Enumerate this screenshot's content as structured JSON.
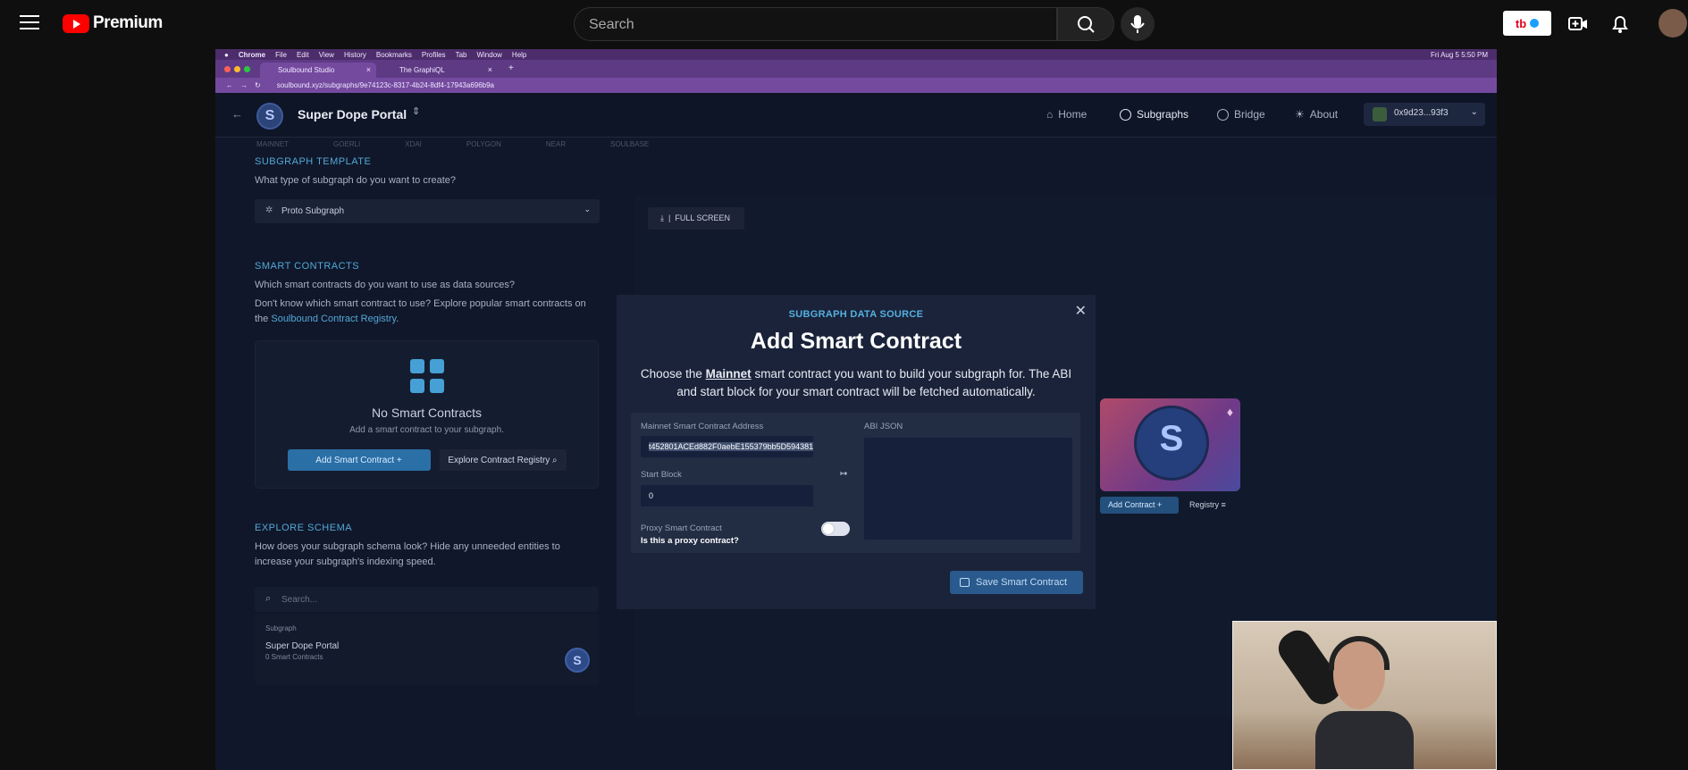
{
  "youtube": {
    "brand": "Premium",
    "search_placeholder": "Search",
    "partner_logo_text": "tb"
  },
  "mac_menu": {
    "items": [
      "Chrome",
      "File",
      "Edit",
      "View",
      "History",
      "Bookmarks",
      "Profiles",
      "Tab",
      "Window",
      "Help"
    ],
    "clock": "Fri Aug 5  5:50 PM"
  },
  "browser": {
    "tabs": [
      {
        "label": "Soulbound Studio",
        "active": true
      },
      {
        "label": "The GraphiQL",
        "active": false
      }
    ],
    "url": "soulbound.xyz/subgraphs/9e74123c-8317-4b24-8df4-17943a696b9a"
  },
  "app": {
    "portal_name": "Super Dope Portal",
    "nav": [
      {
        "label": "Home",
        "active": false
      },
      {
        "label": "Subgraphs",
        "active": true
      },
      {
        "label": "Bridge",
        "active": false
      },
      {
        "label": "About",
        "active": false
      }
    ],
    "wallet": "0x9d23...93f3",
    "chains": [
      "MAINNET",
      "GOERLI",
      "XDAI",
      "POLYGON",
      "NEAR",
      "SOULBASE"
    ]
  },
  "template": {
    "label": "SUBGRAPH TEMPLATE",
    "question": "What type of subgraph do you want to create?",
    "selected": "Proto Subgraph"
  },
  "contracts": {
    "label": "SMART CONTRACTS",
    "question": "Which smart contracts do you want to use as data sources?",
    "hint_prefix": "Don't know which smart contract to use? Explore popular smart contracts on the ",
    "hint_link": "Soulbound Contract Registry",
    "hint_suffix": ".",
    "empty_title": "No Smart Contracts",
    "empty_sub": "Add a smart contract to your subgraph.",
    "add_button": "Add Smart Contract +",
    "registry_button": "Explore Contract Registry ⌕"
  },
  "schema": {
    "label": "EXPLORE SCHEMA",
    "question": "How does your subgraph schema look? Hide any unneeded entities to increase your subgraph's indexing speed.",
    "search_placeholder": "Search...",
    "list_header": "Subgraph",
    "item_name": "Super Dope Portal",
    "item_count": "0 Smart Contracts"
  },
  "canvas": {
    "fullscreen_label": "FULL SCREEN",
    "add_contract": "Add Contract +",
    "registry": "Registry"
  },
  "modal": {
    "kicker": "SUBGRAPH DATA SOURCE",
    "title": "Add Smart Contract",
    "desc_prefix": "Choose the ",
    "desc_network": "Mainnet",
    "desc_suffix": " smart contract you want to build your subgraph for. The ABI and start block for your smart contract will be fetched automatically.",
    "address_label": "Mainnet Smart Contract Address",
    "address_value": "t452801ACEd882F0aebE155379bb5D594381",
    "abi_label": "ABI JSON",
    "start_block_label": "Start Block",
    "start_block_value": "0",
    "proxy_label": "Proxy Smart Contract",
    "proxy_question": "Is this a proxy contract?",
    "proxy_enabled": false,
    "save_button": "Save Smart Contract"
  },
  "colors": {
    "accent": "#52a8d6",
    "page_bg": "#10172a",
    "modal_bg": "#1a2339",
    "primary_button": "#2a6fa6"
  }
}
